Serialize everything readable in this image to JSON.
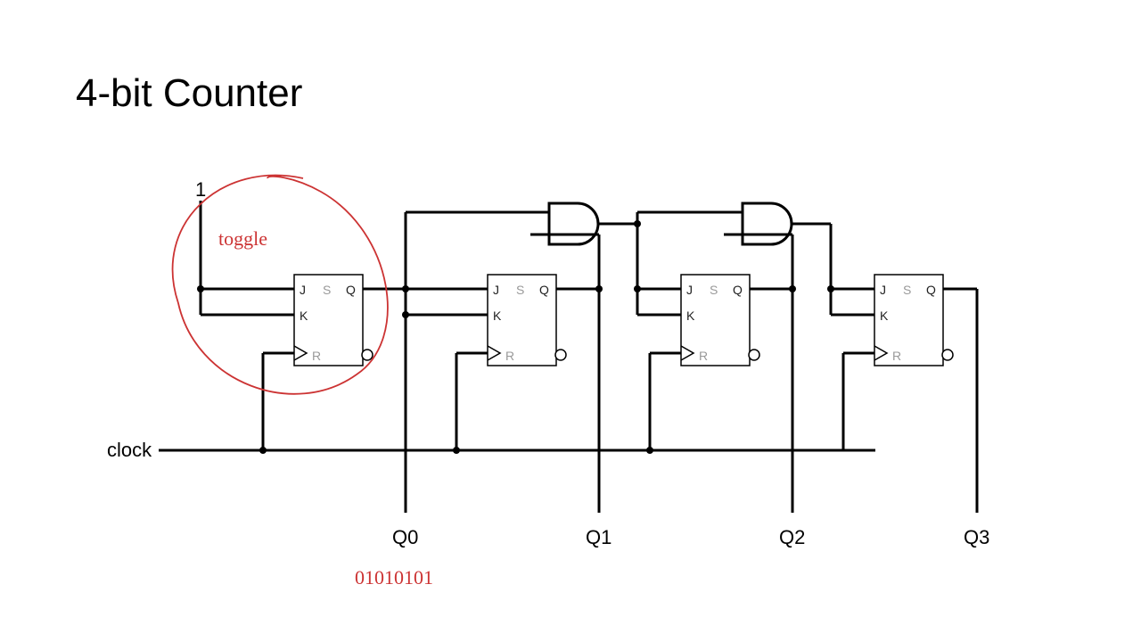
{
  "title": "4-bit Counter",
  "input_label": "1",
  "clock_label": "clock",
  "flipflops": [
    {
      "J": "J",
      "K": "K",
      "S": "S",
      "Q": "Q",
      "R": "R",
      "out": "Q0"
    },
    {
      "J": "J",
      "K": "K",
      "S": "S",
      "Q": "Q",
      "R": "R",
      "out": "Q1"
    },
    {
      "J": "J",
      "K": "K",
      "S": "S",
      "Q": "Q",
      "R": "R",
      "out": "Q2"
    },
    {
      "J": "J",
      "K": "K",
      "S": "S",
      "Q": "Q",
      "R": "R",
      "out": "Q3"
    }
  ],
  "annotation_toggle": "toggle",
  "annotation_sequence": "01010101"
}
